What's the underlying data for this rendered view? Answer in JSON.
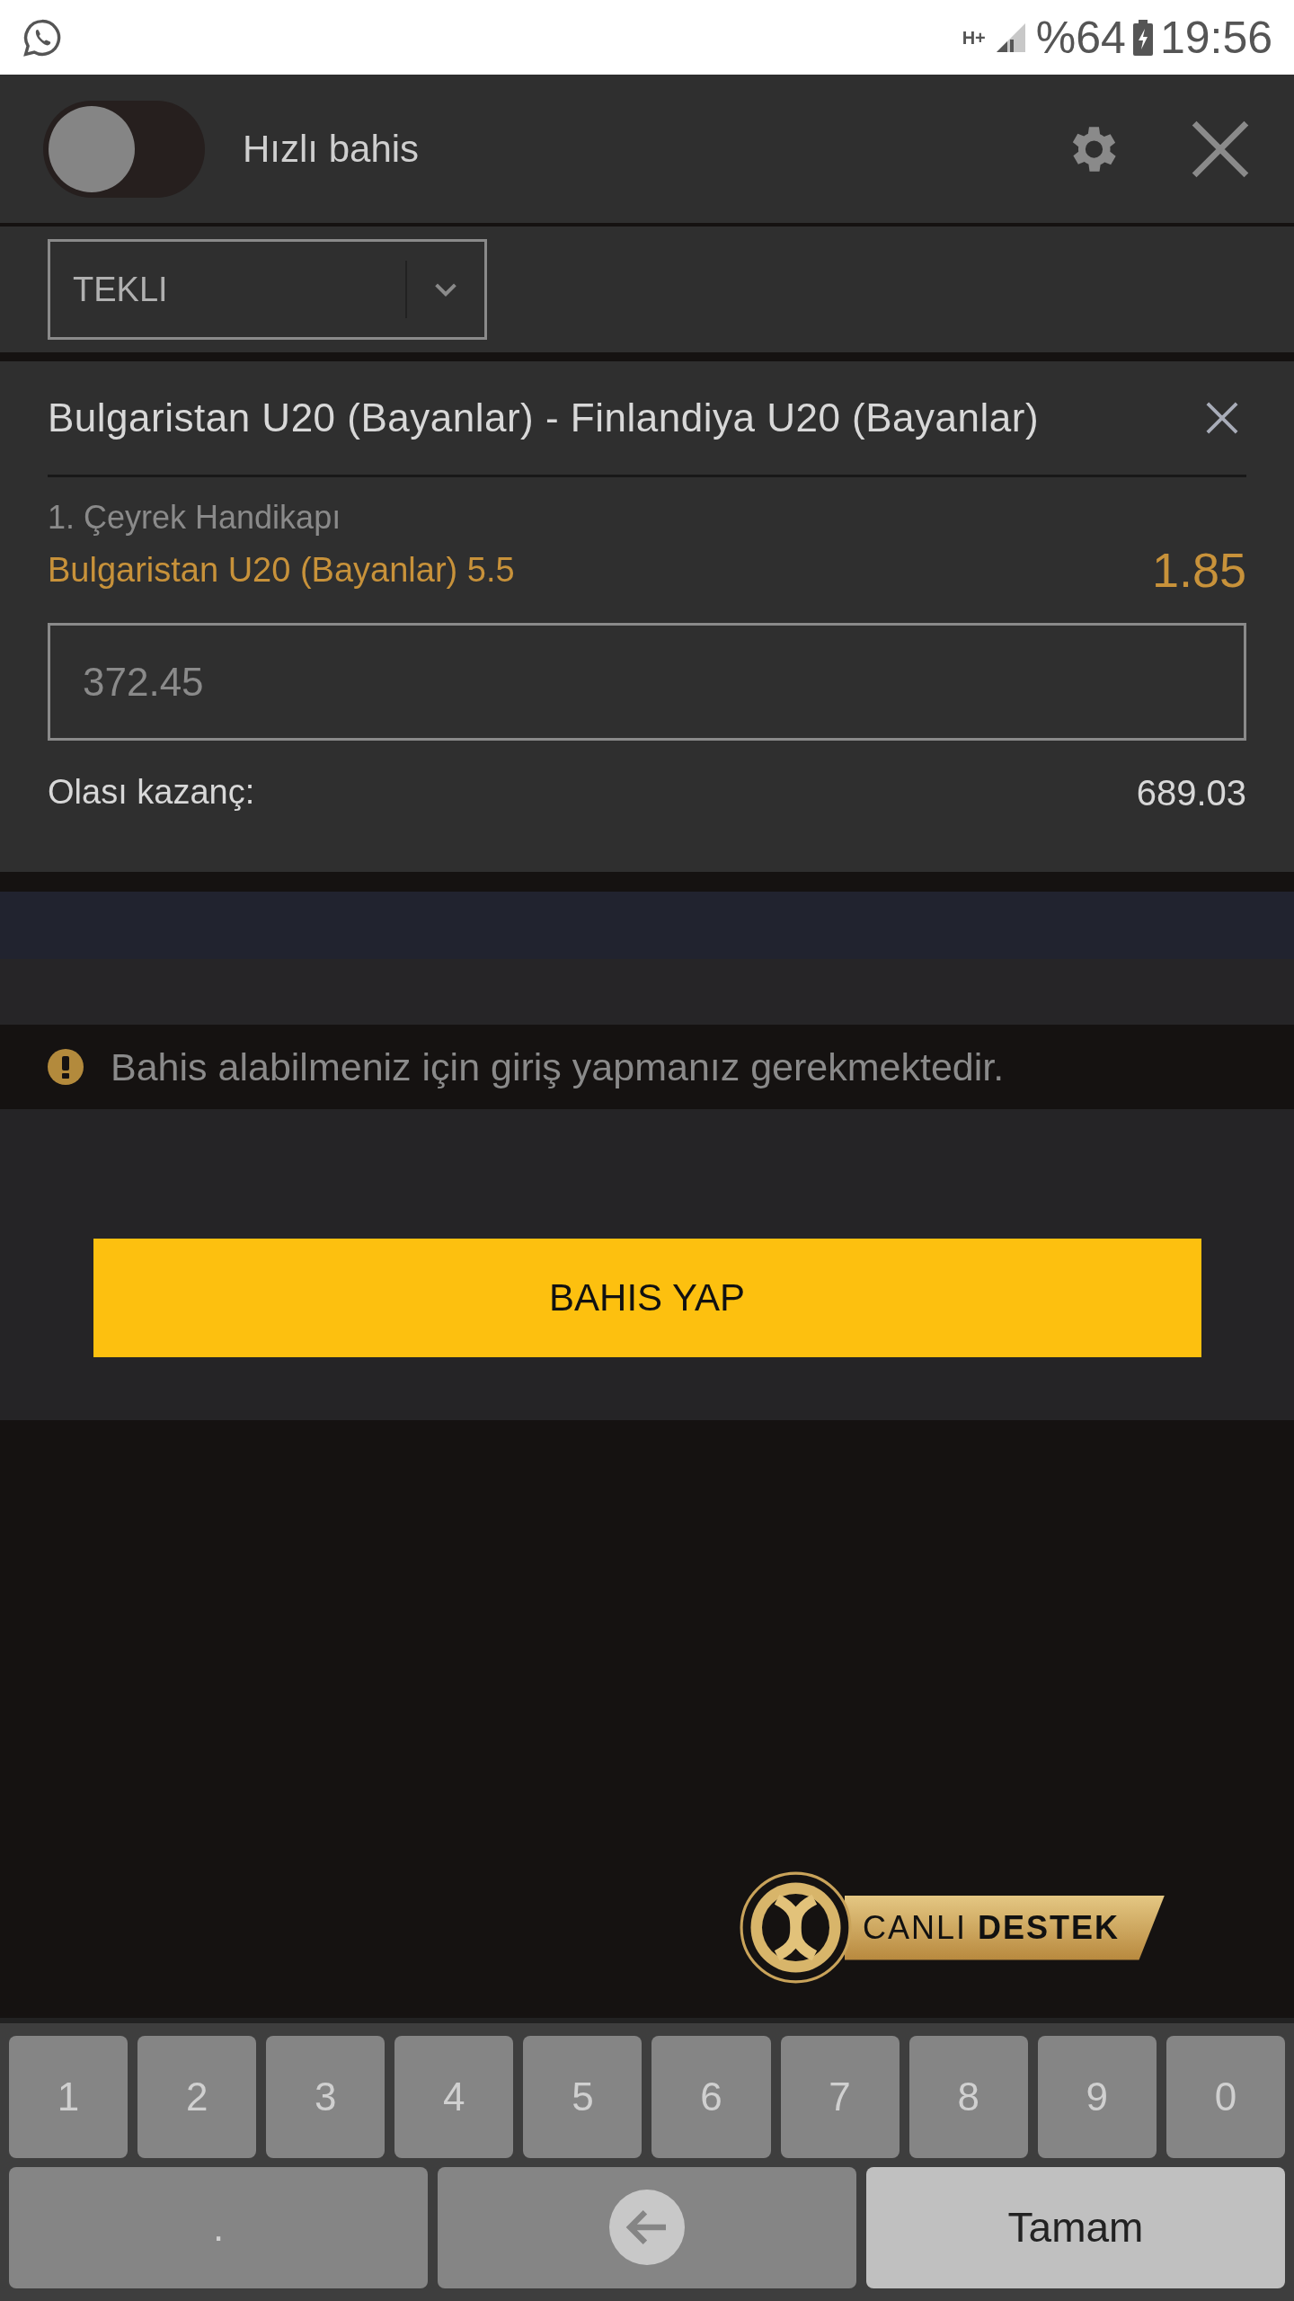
{
  "status_bar": {
    "network": "H+",
    "battery": "%64",
    "time": "19:56"
  },
  "header": {
    "quick_bet_toggle": {
      "label": "Hızlı bahis",
      "on": false
    }
  },
  "bet_type_select": {
    "value": "TEKLI"
  },
  "bet": {
    "match": "Bulgaristan U20 (Bayanlar) - Finlandiya U20 (Bayanlar)",
    "market": "1. Çeyrek Handikapı",
    "selection": "Bulgaristan U20 (Bayanlar) 5.5",
    "odds": "1.85",
    "stake": "372.45",
    "potential_win_label": "Olası kazanç:",
    "potential_win": "689.03"
  },
  "warning": "Bahis alabilmeniz için giriş yapmanız gerekmektedir.",
  "place_bet_button": "BAHIS YAP",
  "live_support": {
    "label_light": "CANLI",
    "label_bold": "DESTEK"
  },
  "keyboard": {
    "digit_keys": [
      "1",
      "2",
      "3",
      "4",
      "5",
      "6",
      "7",
      "8",
      "9",
      "0"
    ],
    "action_keys": [
      {
        "kind": "char",
        "label": "."
      },
      {
        "kind": "backspace"
      },
      {
        "kind": "done",
        "label": "Tamam"
      }
    ]
  }
}
